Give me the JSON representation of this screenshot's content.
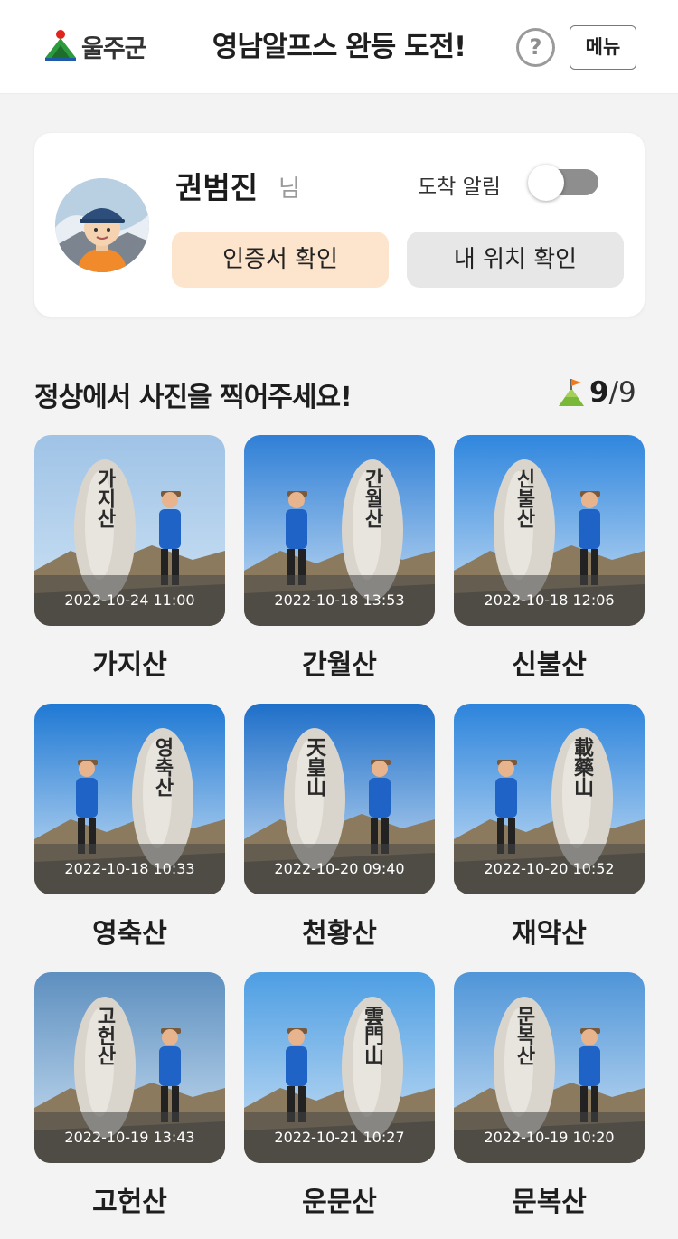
{
  "header": {
    "logo_text": "울주군",
    "title": "영남알프스 완등 도전!",
    "help_label": "?",
    "menu_label": "메뉴"
  },
  "profile": {
    "name": "권범진",
    "suffix": "님",
    "notify_label": "도착 알림",
    "notify_on": false,
    "cert_button": "인증서 확인",
    "location_button": "내 위치 확인"
  },
  "section": {
    "title": "정상에서 사진을 찍어주세요!",
    "completed": "9",
    "total": "/9"
  },
  "mountains": [
    {
      "name": "가지산",
      "timestamp": "2022-10-24 11:00",
      "stone_text": "가지산",
      "sky": "#9fc3e6"
    },
    {
      "name": "간월산",
      "timestamp": "2022-10-18 13:53",
      "stone_text": "간월산",
      "sky": "#2f7fd6"
    },
    {
      "name": "신불산",
      "timestamp": "2022-10-18 12:06",
      "stone_text": "신불산",
      "sky": "#2f86de"
    },
    {
      "name": "영축산",
      "timestamp": "2022-10-18 10:33",
      "stone_text": "영축산",
      "sky": "#1f79d4"
    },
    {
      "name": "천황산",
      "timestamp": "2022-10-20 09:40",
      "stone_text": "天皇山",
      "sky": "#1e6fc9"
    },
    {
      "name": "재약산",
      "timestamp": "2022-10-20 10:52",
      "stone_text": "載藥山",
      "sky": "#2c84dc"
    },
    {
      "name": "고헌산",
      "timestamp": "2022-10-19 13:43",
      "stone_text": "고헌산",
      "sky": "#5d8fbf"
    },
    {
      "name": "운문산",
      "timestamp": "2022-10-21 10:27",
      "stone_text": "雲門山",
      "sky": "#4d9ee3"
    },
    {
      "name": "문복산",
      "timestamp": "2022-10-19 10:20",
      "stone_text": "문복산",
      "sky": "#4f95d8"
    }
  ],
  "colors": {
    "cert_button_bg": "#fde4cc",
    "location_button_bg": "#e7e7e8",
    "toggle_off": "#8e8e8e"
  },
  "icons": {
    "logo": "uljugun-mountain-logo",
    "flag": "summit-flag-icon",
    "help": "question-circle-icon"
  }
}
